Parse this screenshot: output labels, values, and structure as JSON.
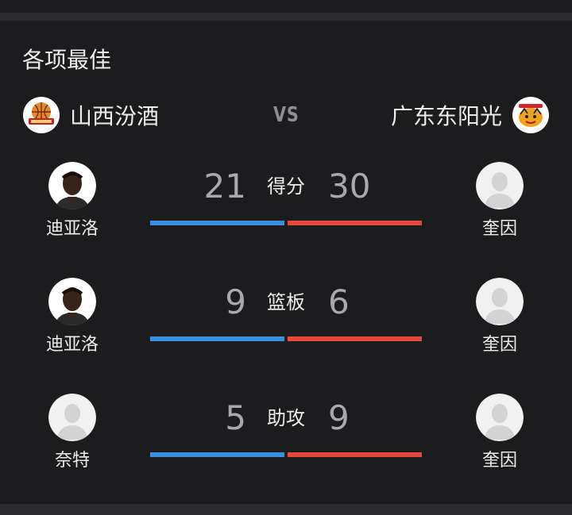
{
  "section": {
    "title": "各项最佳"
  },
  "teams": {
    "home": {
      "name": "山西汾酒",
      "logo_icon": "shanxi-fenjiu-logo"
    },
    "vs": "VS",
    "away": {
      "name": "广东东阳光",
      "logo_icon": "guangdong-southern-tigers-logo"
    }
  },
  "colors": {
    "home_bar": "#3c8fe0",
    "away_bar": "#e8473e",
    "background": "#1c1c1e"
  },
  "stats": [
    {
      "label": "得分",
      "home_value": "21",
      "away_value": "30",
      "home_player": "迪亚洛",
      "away_player": "奎因",
      "home_avatar": "player-photo",
      "away_avatar": "default-avatar-icon"
    },
    {
      "label": "篮板",
      "home_value": "9",
      "away_value": "6",
      "home_player": "迪亚洛",
      "away_player": "奎因",
      "home_avatar": "player-photo",
      "away_avatar": "default-avatar-icon"
    },
    {
      "label": "助攻",
      "home_value": "5",
      "away_value": "9",
      "home_player": "奈特",
      "away_player": "奎因",
      "home_avatar": "default-avatar-icon",
      "away_avatar": "default-avatar-icon"
    }
  ]
}
